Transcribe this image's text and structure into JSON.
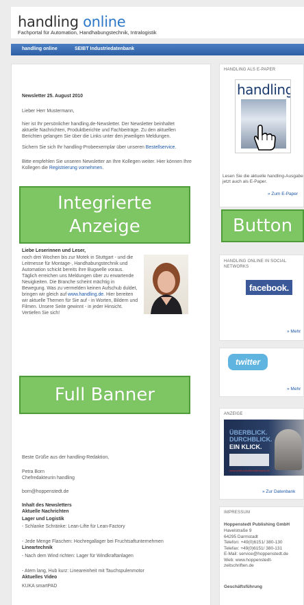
{
  "header": {
    "logo_word1": "handling",
    "logo_word2": "online",
    "tagline": "Fachportal für Automation, Handhabungstechnik, Intralogistik"
  },
  "nav": {
    "items": [
      "handling online",
      "SEIBT Industriedatenbank"
    ]
  },
  "newsletter": {
    "title": "Newsletter 25. August 2010",
    "greeting": "Lieber Herr Mustermann,",
    "intro": "hier ist Ihr persönlicher handling.de-Newsletter. Der Newsletter beinhaltet aktuelle Nachrichten, Produktberichte und Fachbeiträge. Zu den aktuellen Berichten gelangen Sie über die Links unter den jeweiligen Meldungen.",
    "order_text": "Sichern Sie sich Ihr handling-Probeexemplar über unseren",
    "order_link": "Bestellservice",
    "recommend_text": "Bitte empfehlen Sie unseren Newsletter an Ihre Kollegen weiter. Hier können Ihre Kollegen die",
    "recommend_link": "Registrierung vornehmen",
    "editorial_heading": "Liebe Leserinnen und Leser,",
    "editorial_body": "noch drei Wochen bis zur Motek in Stuttgart - und die Leitmesse für Montage-, Handhabungstechnik und Automation schickt bereits ihre Bugwelle voraus. Täglich erreichen uns Meldungen über zu erwartende Neuigkeiten. Die Branche scheint mächtig in Bewegung. Was zu vermelden keinen Aufschub duldet, bringen wir gleich auf",
    "editorial_link": "www.handling.de",
    "editorial_tail": "Hier bereiten wir aktuelle Themen für Sie auf - in Worten, Bildern und Filmen. Unsere Seite gewinnt - in jeder Hinsicht. Vertiefen Sie sich!",
    "closing": "Beste Grüße aus der handling-Redaktion,",
    "signature_name": "Petra Born",
    "signature_role": "Chefredakteurin handling",
    "email": "born@hoppenstedt.de"
  },
  "contents": {
    "heading": "Inhalt des Newsletters",
    "sections": [
      {
        "title": "Aktuelle Nachrichten",
        "items": []
      },
      {
        "title": "Lager und Logistik",
        "items": [
          "- Schlanke Schränke: Lean-Lifte für Lean-Factory",
          "- Jede Menge Flaschen: Hochregallager bei Fruchtsaftunternehmen"
        ]
      },
      {
        "title": "Lineartechnik",
        "items": [
          "- Nach dem Wind richten: Lager für Windkraftanlagen",
          "- Atem lang, Hub kurz: Lineareinheit mit Tauchspulenmotor"
        ]
      },
      {
        "title": "Aktuelles Video",
        "items": [
          "KUKA smartPAD"
        ]
      }
    ]
  },
  "overlays": {
    "ad_label": "Integrierte Anzeige",
    "banner_label": "Full Banner",
    "button_label": "Button"
  },
  "sidebar": {
    "epaper": {
      "title": "HANDLING ALS E-PAPER",
      "cover_title": "handling",
      "text": "Lesen Sie die aktuelle handling-Ausgabe jetzt auch als E-Paper.",
      "link": "» Zum E-Paper"
    },
    "social": {
      "title": "HANDLING ONLINE IN SOCIAL NETWORKS",
      "facebook_label": "facebook.",
      "facebook_more": "» Mehr",
      "twitter_label": "twitter",
      "twitter_more": "» Mehr"
    },
    "ad": {
      "title": "ANZEIGE",
      "line1": "ÜBERBLICK.",
      "line2": "DURCHBLICK.",
      "line3": "EIN KLICK.",
      "url": "www.seibt-industriedatenbank.de",
      "link": "» Zur Datenbank"
    },
    "impressum": {
      "title": "IMPRESSUM",
      "company": "Hoppenstedt Publishing GmbH",
      "lines": [
        "Havelstraße 9",
        "64295 Darmstadt",
        "Telefon: +49(0)6151/ 380-130",
        "Telefax: +49(0)6151/ 380-131",
        "E-Mail: service@hoppenstedt.de",
        "Web: www.hoppenstedt-zeitschriften.de"
      ],
      "management": "Geschäftsführung"
    }
  },
  "colors": {
    "nav_blue": "#2d5fa4",
    "link_blue": "#1a56a8",
    "overlay_green": "#7dc663",
    "facebook_blue": "#3b5998",
    "twitter_blue": "#5fb4e0"
  }
}
